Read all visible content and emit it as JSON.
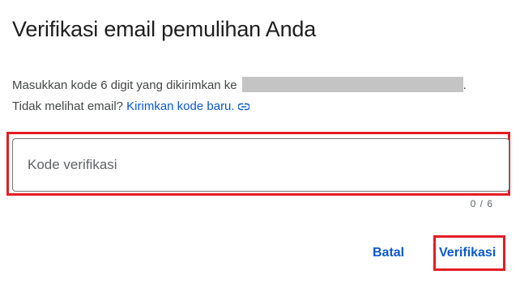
{
  "dialog": {
    "title": "Verifikasi email pemulihan Anda",
    "description_line1": "Masukkan kode 6 digit yang dikirimkan ke",
    "description_line1_end": ".",
    "description_line2": "Tidak melihat email?",
    "resend_link": "Kirimkan kode baru.",
    "resend_icon": "link-icon"
  },
  "verification_input": {
    "placeholder": "Kode verifikasi",
    "value": "",
    "counter": "0 / 6"
  },
  "actions": {
    "cancel_label": "Batal",
    "verify_label": "Verifikasi"
  },
  "colors": {
    "accent": "#0b57d0",
    "highlight": "#e31d24",
    "redaction": "#c4c4c4"
  }
}
